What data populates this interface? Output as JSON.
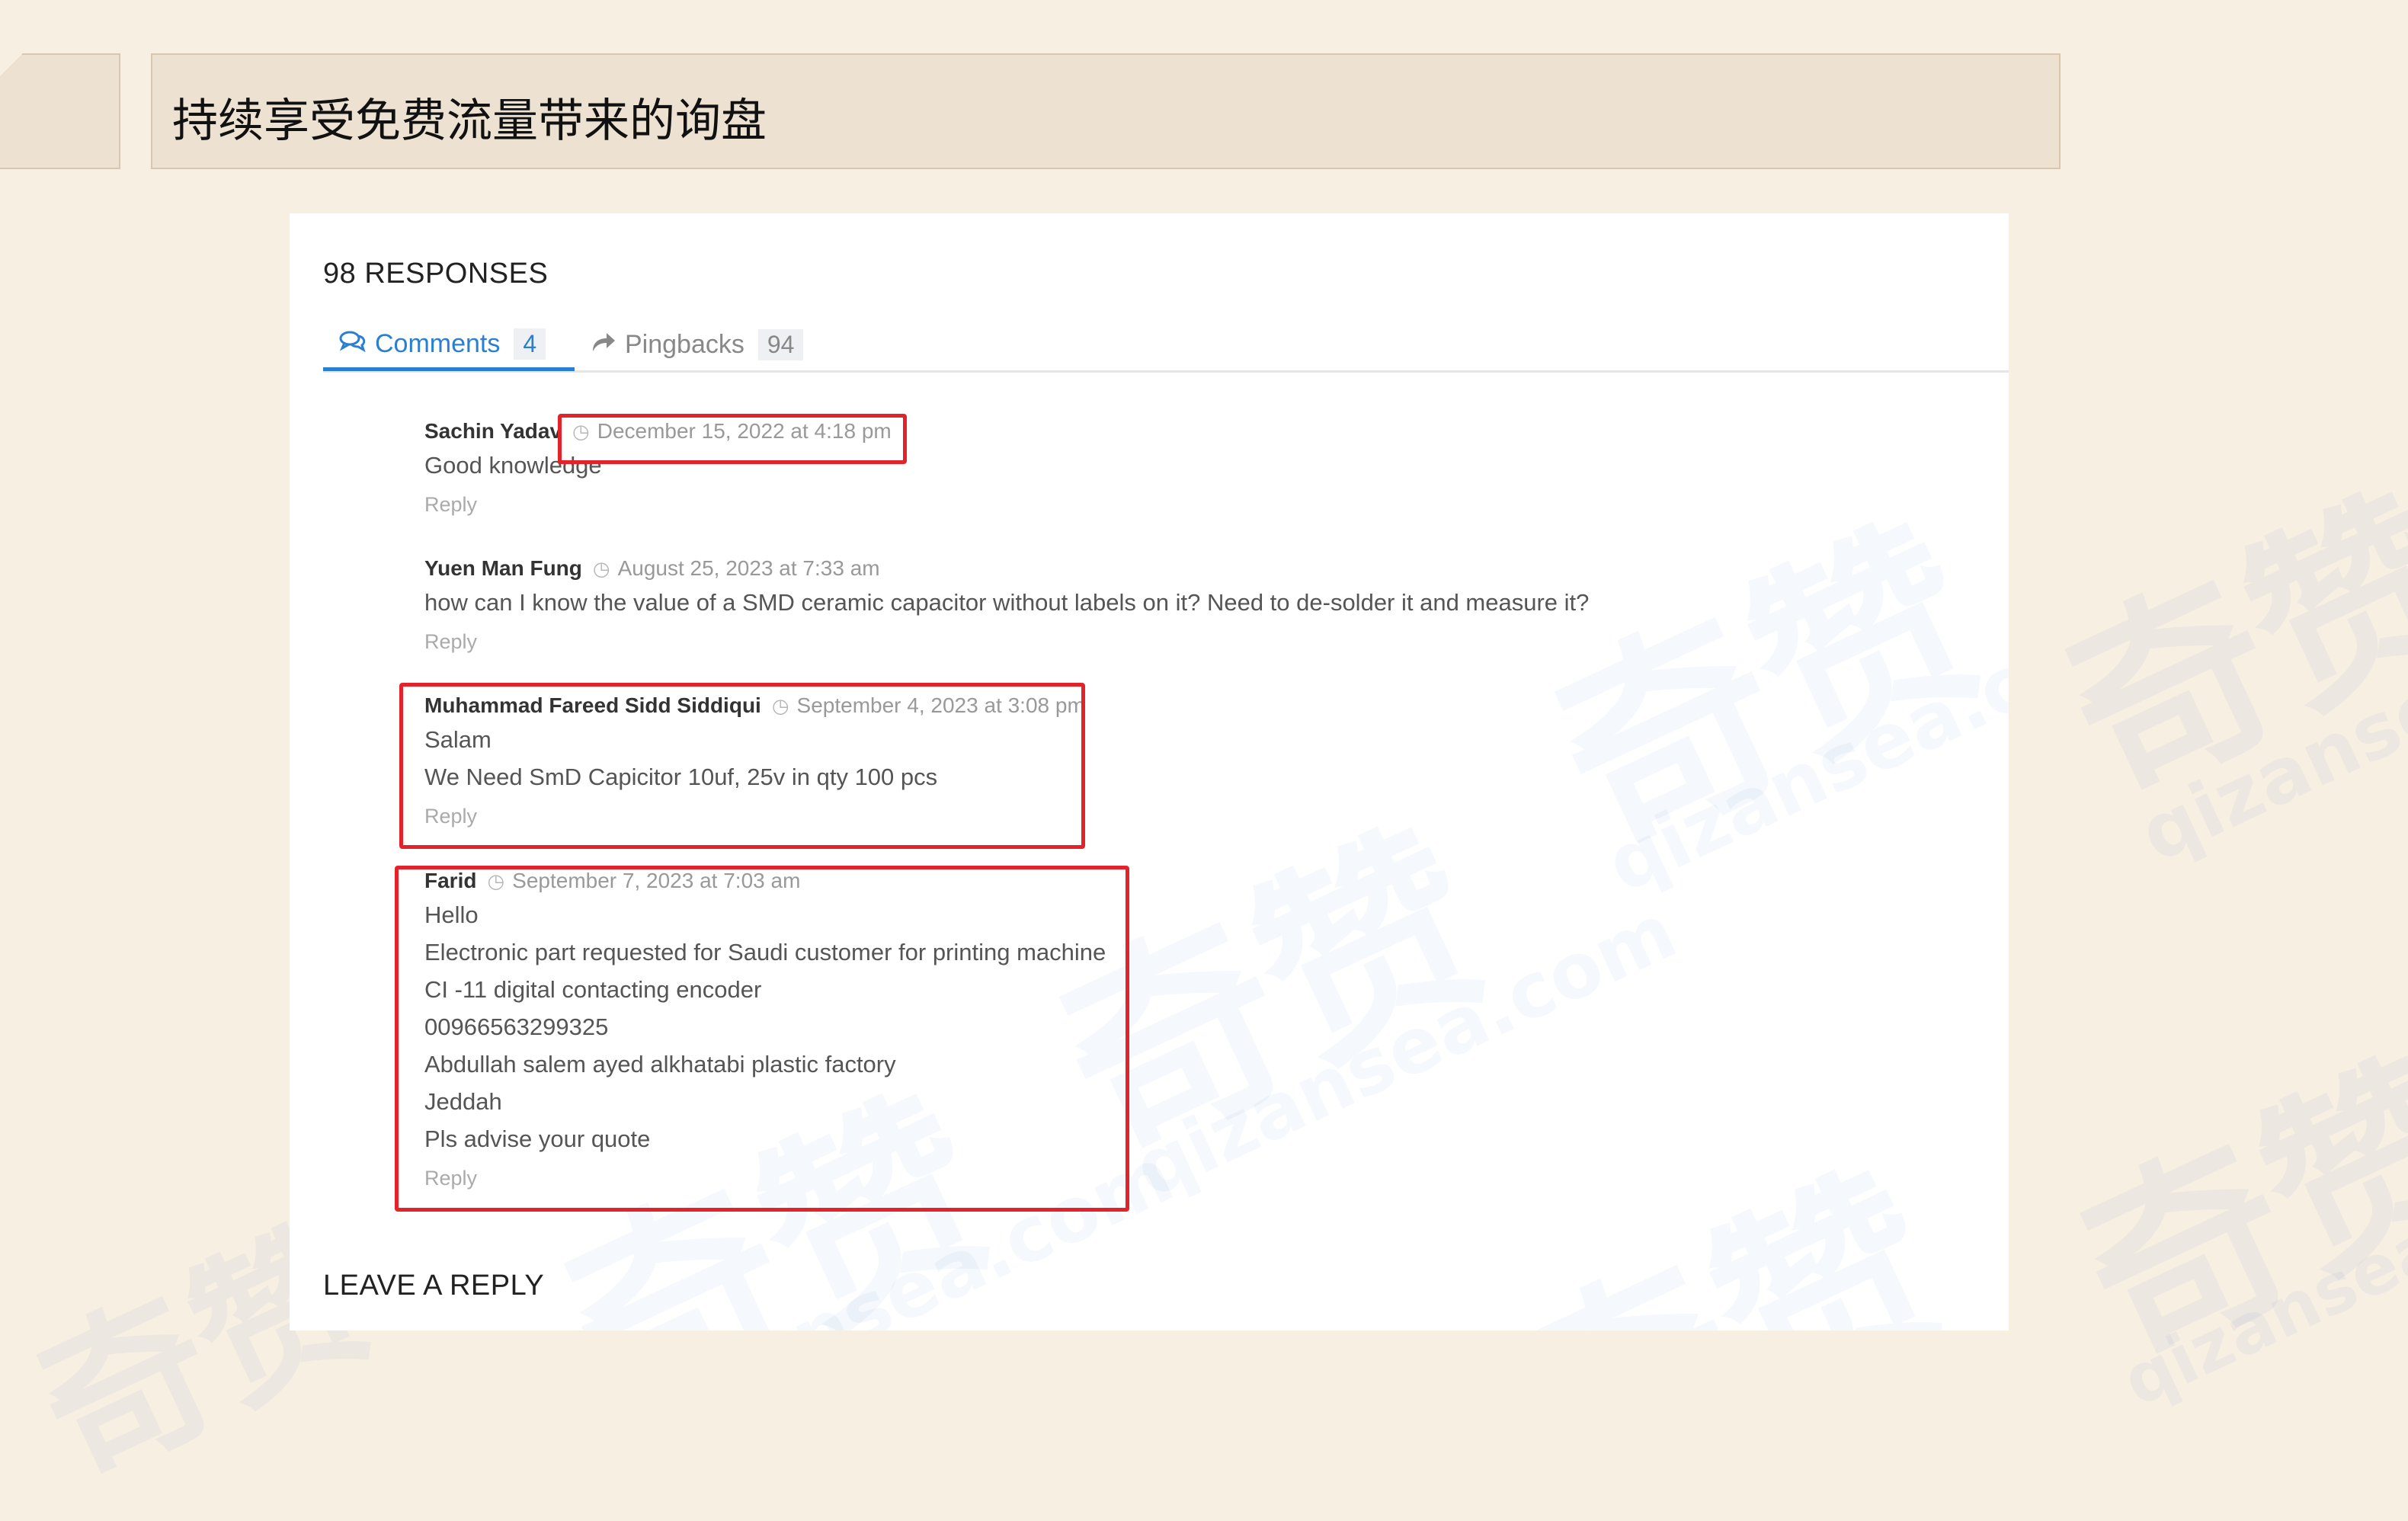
{
  "slide": {
    "title": "持续享受免费流量带来的询盘"
  },
  "watermark": {
    "text_cn": "奇赞",
    "text_en": "qizansea.com"
  },
  "panel": {
    "responses_heading": "98 RESPONSES",
    "tabs": [
      {
        "label": "Comments",
        "count": "4",
        "icon": "comments-icon",
        "active": true
      },
      {
        "label": "Pingbacks",
        "count": "94",
        "icon": "share-arrow-icon",
        "active": false
      }
    ],
    "comments": [
      {
        "author": "Sachin Yadav",
        "date": "December 15, 2022 at 4:18 pm",
        "lines": [
          "Good knowledge"
        ],
        "reply": "Reply"
      },
      {
        "author": "Yuen Man Fung",
        "date": "August 25, 2023 at 7:33 am",
        "lines": [
          "how can I know the value of a SMD ceramic capacitor without labels on it? Need to de-solder it and measure it?"
        ],
        "reply": "Reply"
      },
      {
        "author": "Muhammad Fareed Sidd Siddiqui",
        "date": "September 4, 2023 at 3:08 pm",
        "lines": [
          "Salam",
          "We Need SmD Capicitor 10uf, 25v in qty 100 pcs"
        ],
        "reply": "Reply"
      },
      {
        "author": "Farid",
        "date": "September 7, 2023 at 7:03 am",
        "lines": [
          "Hello",
          "Electronic part requested for Saudi customer for printing machine",
          "CI -11 digital contacting encoder",
          "00966563299325",
          "Abdullah salem ayed alkhatabi plastic factory",
          "Jeddah",
          "Pls advise your quote"
        ],
        "reply": "Reply"
      }
    ],
    "leave_reply": "LEAVE A REPLY"
  },
  "colors": {
    "background": "#f7f0e2",
    "title_bar": "#ede2d1",
    "accent_blue": "#2a7fd1",
    "highlight_red": "#e4222a"
  }
}
